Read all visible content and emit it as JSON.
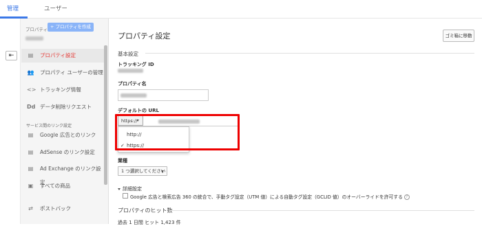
{
  "topnav": {
    "tab_admin": "管理",
    "tab_user": "ユーザー"
  },
  "sidebar": {
    "back_icon": "arrow-left-icon",
    "property_label": "プロパティ",
    "create_button": "+ プロパティを作成",
    "items": [
      {
        "label": "プロパティ設定",
        "icon": "document-icon",
        "active": true
      },
      {
        "label": "プロパティ ユーザーの管理",
        "icon": "users-icon"
      },
      {
        "label": "トラッキング情報",
        "icon": "code-icon"
      },
      {
        "label": "データ削除リクエスト",
        "icon": "dd-icon"
      }
    ],
    "section_header": "サービス間のリンク設定",
    "link_items": [
      {
        "label": "Google 広告とのリンク",
        "icon": "ads-icon"
      },
      {
        "label": "AdSense のリンク設定",
        "icon": "adsense-icon"
      },
      {
        "label": "Ad Exchange のリンク設定",
        "icon": "adexchange-icon"
      },
      {
        "label": "すべての商品",
        "icon": "products-icon"
      },
      {
        "label": "ポストバック",
        "icon": "postback-icon"
      }
    ]
  },
  "main": {
    "title": "プロパティ設定",
    "trash_button": "ゴミ箱に移動",
    "basic_settings": "基本設定",
    "tracking_id_label": "トラッキング ID",
    "property_name_label": "プロパティ名",
    "default_url_label": "デフォルトの URL",
    "scheme_selected": "https://",
    "scheme_options": [
      "http://",
      "https://"
    ],
    "industry_label": "業種",
    "industry_select": "1 つ選択してください",
    "details_label": "詳細設定",
    "checkbox_label": "Google 広告と検索広告 360 の統合で、手動タグ設定（UTM 値）による自動タグ設定（GCLID 値）のオーバーライドを許可する",
    "hits_header": "プロパティのヒット数",
    "hits_row": "過去 1 日間  ヒット 1,423 件"
  },
  "colors": {
    "accent": "#3b78e7",
    "active_red": "#e53935",
    "highlight": "#ee0000"
  }
}
